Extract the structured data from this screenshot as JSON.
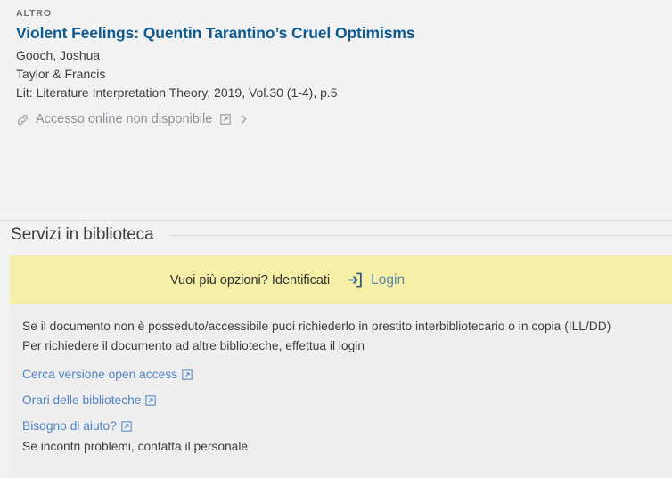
{
  "record": {
    "type_label": "ALTRO",
    "title": "Violent Feelings: Quentin Tarantino’s Cruel Optimisms",
    "author": "Gooch, Joshua",
    "publisher": "Taylor & Francis",
    "source": "Lit: Literature Interpretation Theory, 2019, Vol.30 (1-4), p.5",
    "availability": {
      "label": "Accesso online non disponibile",
      "chain_icon": "link-icon",
      "external_icon": "external-link-icon",
      "chevron_icon": "chevron-right-icon"
    }
  },
  "services": {
    "heading": "Servizi in biblioteca",
    "signin_banner": {
      "prompt": "Vuoi più opzioni? Identificati",
      "login_label": "Login",
      "login_icon": "login-icon",
      "background_color": "#f6efa8"
    },
    "notes": [
      "Se il documento non è posseduto/accessibile puoi richiederlo in prestito interbibliotecario o in copia (ILL/DD)",
      "Per richiedere il documento ad altre biblioteche, effettua il login"
    ],
    "links": [
      {
        "label": "Cerca versione open access",
        "icon": "external-link-icon",
        "sub": null
      },
      {
        "label": "Orari delle biblioteche",
        "icon": "external-link-icon",
        "sub": null
      },
      {
        "label": "Bisogno di aiuto?",
        "icon": "external-link-icon",
        "sub": "Se incontri problemi, contatta il personale"
      }
    ]
  },
  "colors": {
    "page_background": "#f2f2f2",
    "panel_background": "#eeeeee",
    "title_blue": "#0d5b91",
    "link_blue": "#4e84c4",
    "banner_yellow": "#f6efa8",
    "muted_text": "#8b9094"
  }
}
